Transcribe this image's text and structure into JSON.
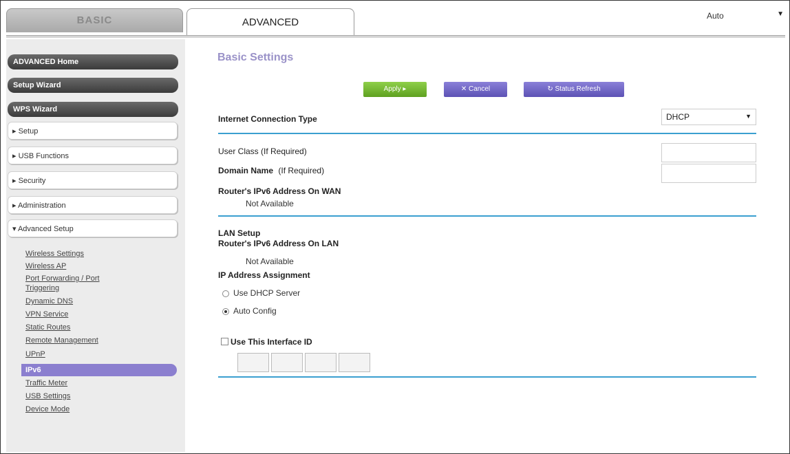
{
  "tabs": {
    "basic": "BASIC",
    "advanced": "ADVANCED"
  },
  "language_select": {
    "value": "Auto"
  },
  "sidebar": {
    "dark_buttons": [
      "ADVANCED Home",
      "Setup Wizard",
      "WPS Wizard"
    ],
    "menu": [
      "▸ Setup",
      "▸ USB Functions",
      "▸ Security",
      "▸ Administration",
      "▾ Advanced Setup"
    ],
    "sublinks": [
      "Wireless Settings",
      "Wireless AP",
      "Port Forwarding / Port",
      "Triggering",
      "Dynamic DNS",
      "VPN Service",
      "Static Routes",
      "Remote Management",
      "UPnP",
      "IPv6",
      "Traffic Meter",
      "USB Settings",
      "Device Mode"
    ]
  },
  "main": {
    "title": "Basic Settings",
    "buttons": {
      "apply": "Apply ▸",
      "cancel": "✕ Cancel",
      "refresh": "↻ Status Refresh"
    },
    "connection_type_label": "Internet Connection Type",
    "connection_type_value": "DHCP",
    "user_class_label": "User Class (If Required)",
    "domain_name_label": "Domain Name",
    "domain_name_suffix": "(If Required)",
    "wan_addr_label": "Router's IPv6 Address On WAN",
    "wan_addr_value": "Not Available",
    "lan_setup_label": "LAN Setup",
    "lan_addr_label": "Router's IPv6 Address On LAN",
    "lan_addr_value": "Not Available",
    "ip_assignment_label": "IP Address Assignment",
    "radio_dhcp": "Use DHCP Server",
    "radio_auto": "Auto Config",
    "use_interface_id": "Use This Interface ID"
  }
}
